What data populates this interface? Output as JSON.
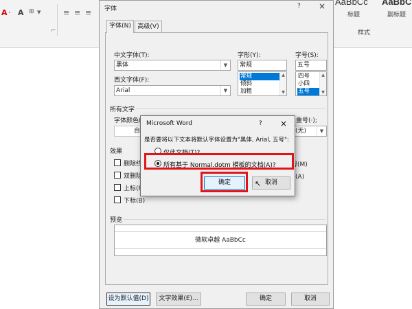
{
  "ribbon": {
    "font_glyphs": [
      "A",
      "·",
      "A"
    ],
    "style_previews": [
      "AaBbCc",
      "AaBbC"
    ],
    "styles": [
      "标题",
      "副标题"
    ],
    "group_label": "样式"
  },
  "font_dialog": {
    "title": "字体",
    "help": "?",
    "close": "×",
    "tabs": [
      {
        "label": "字体(N)",
        "active": true
      },
      {
        "label": "高级(V)",
        "active": false
      }
    ],
    "chinese_font_label": "中文字体(T):",
    "chinese_font_value": "黑体",
    "western_font_label": "西文字体(F):",
    "western_font_value": "Arial",
    "style_label": "字形(Y):",
    "style_value": "常规",
    "style_list": [
      "常规",
      "倾斜",
      "加粗"
    ],
    "style_selected": "常规",
    "size_label": "字号(S):",
    "size_value": "五号",
    "size_list": [
      "四号",
      "小四",
      "五号"
    ],
    "size_selected": "五号",
    "all_text_label": "所有文字",
    "font_color_label": "字体颜色(",
    "font_color_value": "自动",
    "emphasis_label_partial": "重号(·);",
    "emphasis_value": "(无)",
    "effects_label": "效果",
    "effects": [
      "删除线",
      "双删除",
      "上标(P",
      "下标(B)"
    ],
    "effects_right": [
      "体大写字母(M)",
      "大写字母(A)"
    ],
    "preview_label": "预览",
    "preview_text": "微软卓越  AaBbCc",
    "set_default_button": "设为默认值(D)",
    "text_effects_button": "文字效果(E)...",
    "ok_button": "确定",
    "cancel_button": "取消"
  },
  "confirm_dialog": {
    "title": "Microsoft Word",
    "help": "?",
    "close": "×",
    "message": "是否要将以下文本将默认字体设置为\"黑体, Arial, 五号\":",
    "options": [
      {
        "label": "仅此文档(T)?",
        "selected": false
      },
      {
        "label": "所有基于 Normal.dotm 模板的文档(A)?",
        "selected": true
      }
    ],
    "ok_button": "确定",
    "cancel_button": "取消"
  },
  "colors": {
    "highlight": "#e0151a",
    "selection": "#0078d7"
  }
}
